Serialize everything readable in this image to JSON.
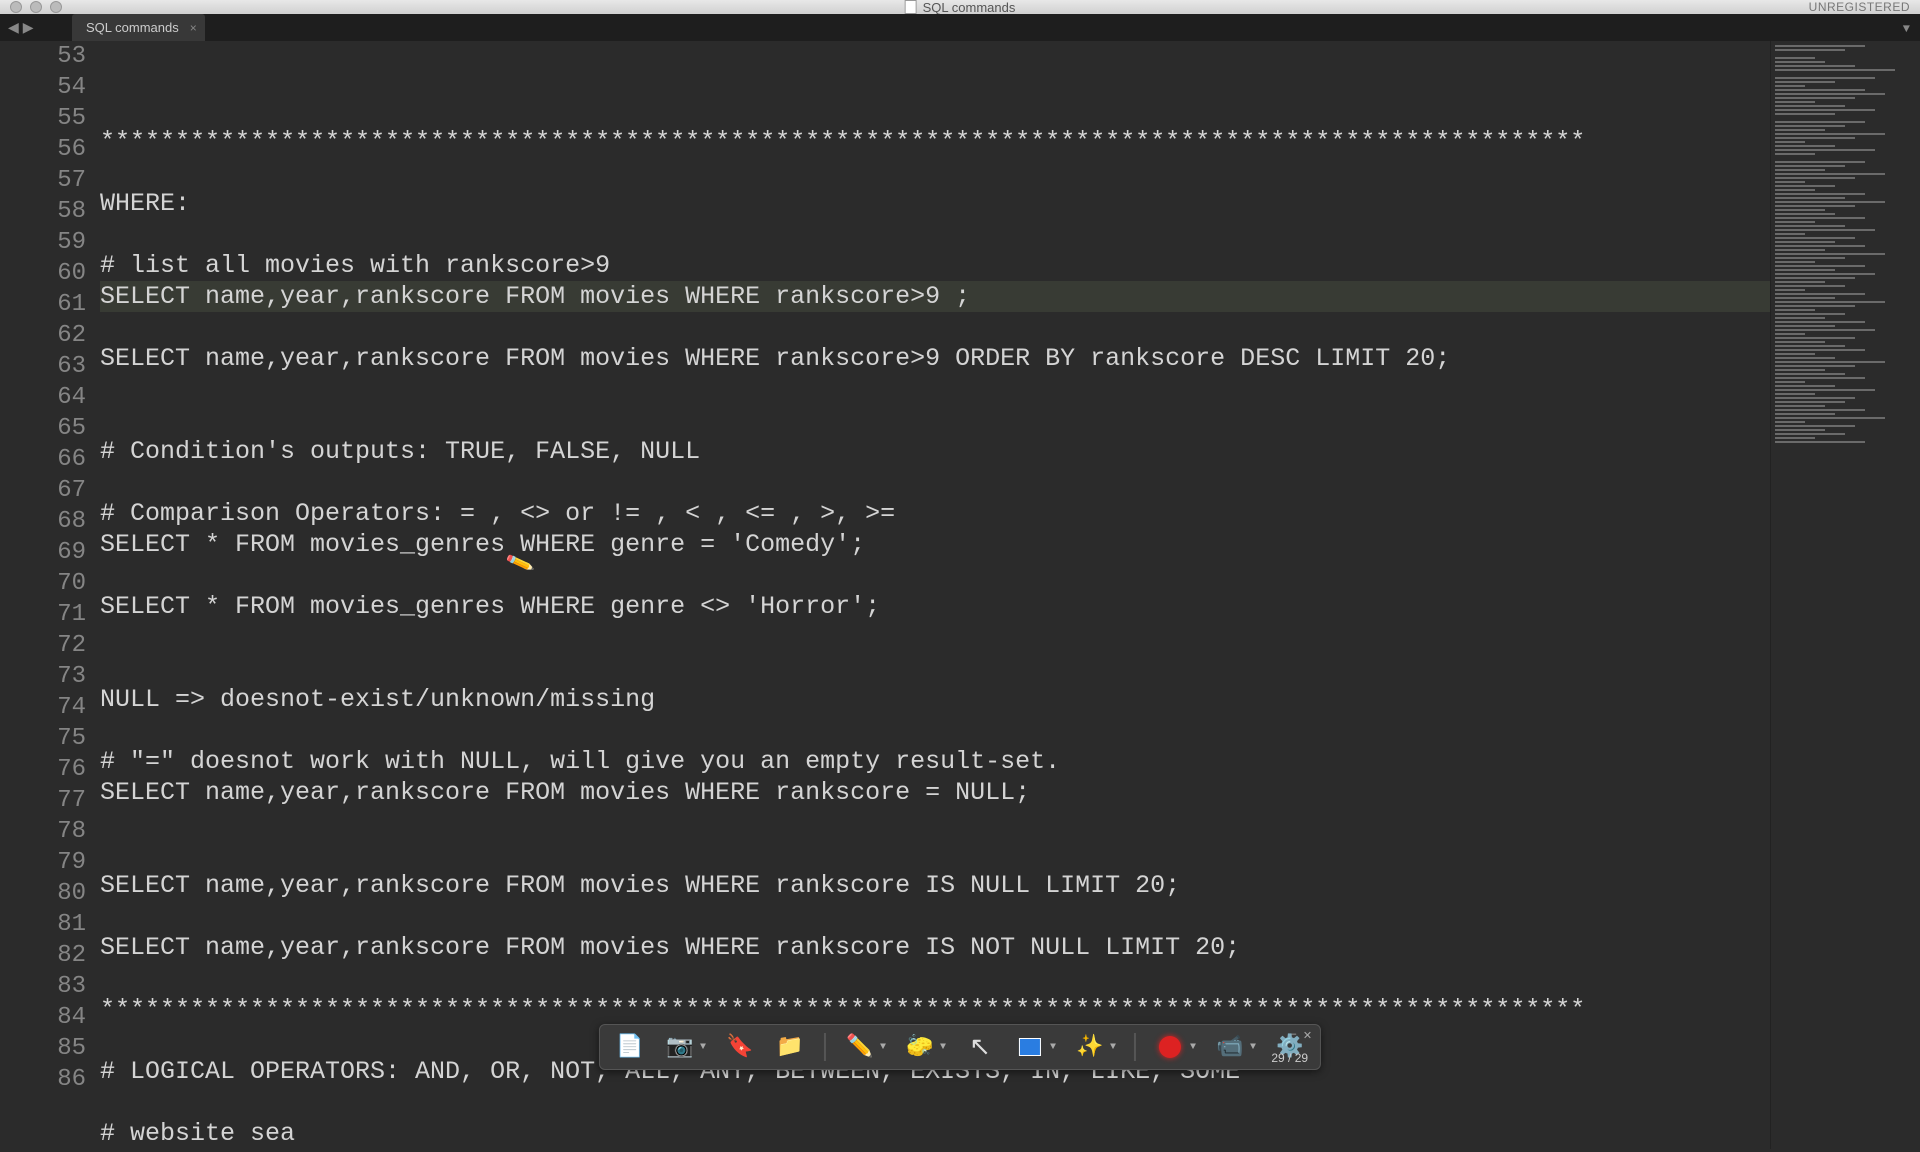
{
  "titlebar": {
    "title": "SQL commands",
    "unregistered": "UNREGISTERED"
  },
  "tabs": {
    "active": "SQL commands",
    "close": "×",
    "nav_back": "◀",
    "nav_fwd": "▶",
    "context": "▼"
  },
  "gutter_start": 53,
  "lines": [
    "",
    "***************************************************************************************************",
    "",
    "WHERE:",
    "",
    "# list all movies with rankscore>9",
    "SELECT name,year,rankscore FROM movies WHERE rankscore>9 ;",
    "",
    "SELECT name,year,rankscore FROM movies WHERE rankscore>9 ORDER BY rankscore DESC LIMIT 20;",
    "",
    "",
    "# Condition's outputs: TRUE, FALSE, NULL",
    "",
    "# Comparison Operators: = , <> or != , < , <= , >, >=",
    "SELECT * FROM movies_genres WHERE genre = 'Comedy';",
    "",
    "SELECT * FROM movies_genres WHERE genre <> 'Horror';",
    "",
    "",
    "NULL => doesnot-exist/unknown/missing",
    "",
    "# \"=\" doesnot work with NULL, will give you an empty result-set.",
    "SELECT name,year,rankscore FROM movies WHERE rankscore = NULL;",
    "",
    "",
    "SELECT name,year,rankscore FROM movies WHERE rankscore IS NULL LIMIT 20;",
    "",
    "SELECT name,year,rankscore FROM movies WHERE rankscore IS NOT NULL LIMIT 20;",
    "",
    "***************************************************************************************************",
    "",
    "# LOGICAL OPERATORS: AND, OR, NOT, ALL, ANY, BETWEEN, EXISTS, IN, LIKE, SOME",
    "",
    "# website sea"
  ],
  "highlighted_line_index": 6,
  "dock": {
    "counter": "29 / 29"
  }
}
